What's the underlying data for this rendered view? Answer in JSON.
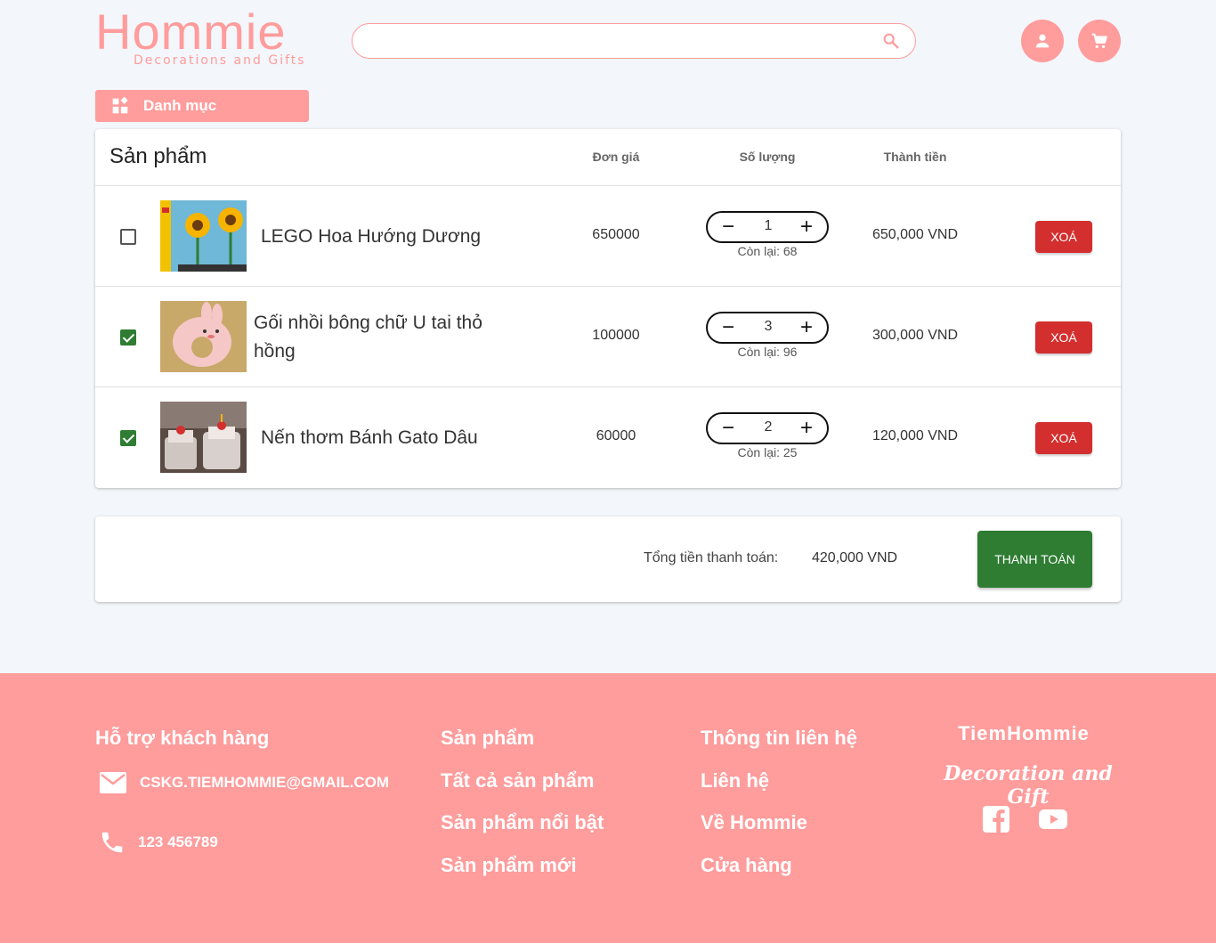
{
  "header": {
    "logo_main": "Hommie",
    "logo_sub": "Decorations and Gifts",
    "search_placeholder": "",
    "category_label": "Danh mục"
  },
  "cart": {
    "headers": {
      "product": "Sản phẩm",
      "price": "Đơn giá",
      "quantity": "Số lượng",
      "total": "Thành tiền"
    },
    "items": [
      {
        "name": "LEGO Hoa Hướng Dương",
        "price": "650000",
        "qty": "1",
        "stock": "Còn lại: 68",
        "total": "650,000 VND",
        "checked": false,
        "delete_label": "XOÁ"
      },
      {
        "name": "Gối nhồi bông chữ U tai thỏ hồng",
        "price": "100000",
        "qty": "3",
        "stock": "Còn lại: 96",
        "total": "300,000 VND",
        "checked": true,
        "delete_label": "XOÁ"
      },
      {
        "name": "Nến thơm Bánh Gato Dâu",
        "price": "60000",
        "qty": "2",
        "stock": "Còn lại: 25",
        "total": "120,000 VND",
        "checked": true,
        "delete_label": "XOÁ"
      }
    ]
  },
  "summary": {
    "label": "Tổng tiền thanh toán:",
    "value": "420,000 VND",
    "pay_label": "THANH TOÁN"
  },
  "footer": {
    "support_title": "Hỗ trợ khách hàng",
    "email": "CSKG.TIEMHOMMIE@GMAIL.COM",
    "phone": "123 456789",
    "products_title": "Sản phẩm",
    "products_links": [
      "Tất cả sản phẩm",
      "Sản phẩm nổi bật",
      "Sản phẩm mới"
    ],
    "contact_title": "Thông tin liên hệ",
    "contact_links": [
      "Liên hệ",
      "Về Hommie",
      "Cửa hàng"
    ],
    "brand": "TiemHommie",
    "brand_sub": "Decoration and Gift"
  },
  "colors": {
    "brand_pink": "#ff9c9c",
    "delete_red": "#d32f2f",
    "pay_green": "#2e7d32",
    "background": "#f3f6fa"
  }
}
